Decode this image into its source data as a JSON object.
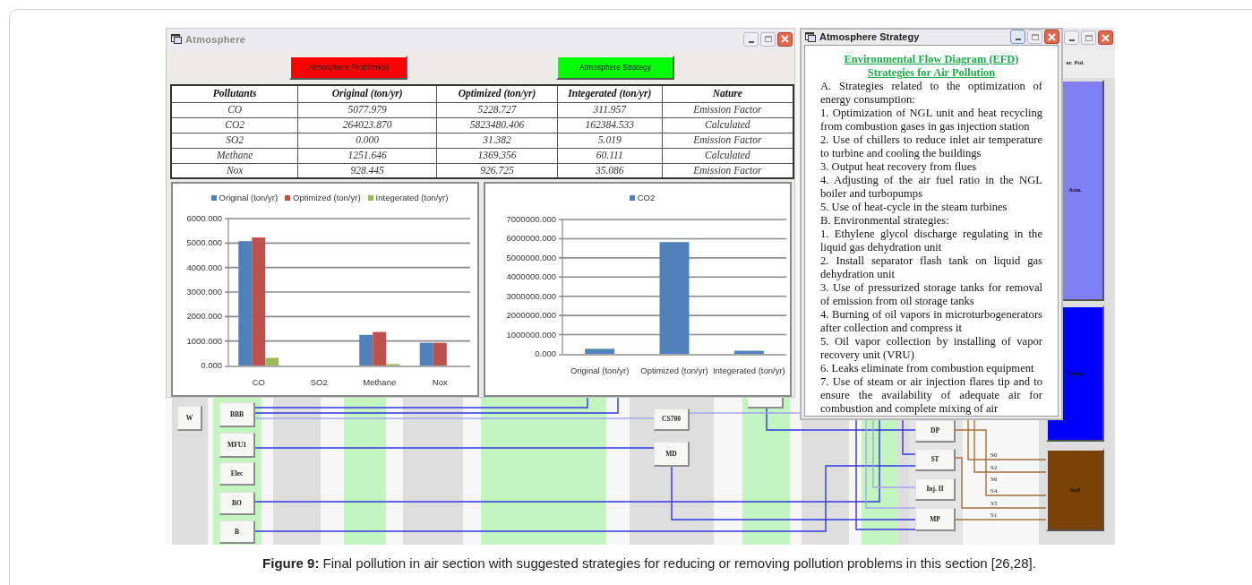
{
  "atmosphere_window": {
    "title": "Atmosphere",
    "buttons": [
      {
        "label": "Atmosphere Problem(s)",
        "color": "#ff0000"
      },
      {
        "label": "Atmosphere Strategy",
        "color": "#00ff00"
      }
    ],
    "table": {
      "columns": [
        "Pollutants",
        "Original (ton/yr)",
        "Optimized (ton/yr)",
        "Integerated (ton/yr)",
        "Nature"
      ],
      "rows": [
        [
          "CO",
          "5077.979",
          "5228.727",
          "311.957",
          "Emission Factor"
        ],
        [
          "CO2",
          "264023.870",
          "5823480.406",
          "162384.533",
          "Calculated"
        ],
        [
          "SO2",
          "0.000",
          "31.382",
          "5.019",
          "Emission Factor"
        ],
        [
          "Methane",
          "1251.646",
          "1369.356",
          "60.111",
          "Calculated"
        ],
        [
          "Nox",
          "928.445",
          "926.725",
          "35.086",
          "Emission Factor"
        ]
      ]
    },
    "charts": [
      {
        "chart_data": {
          "type": "bar",
          "legend": "top",
          "grid": true,
          "categories": [
            "CO",
            "SO2",
            "Methane",
            "Nox"
          ],
          "series": [
            {
              "name": "Original (ton/yr)",
              "color": "#4f81bd",
              "values": [
                5078,
                0,
                1252,
                928
              ]
            },
            {
              "name": "Optimized (ton/yr)",
              "color": "#c0504d",
              "values": [
                5229,
                null,
                1369,
                927
              ]
            },
            {
              "name": "Integerated (ton/yr)",
              "color": "#9bbb59",
              "values": [
                312,
                null,
                60,
                null
              ]
            }
          ],
          "ylim": [
            0,
            6000
          ],
          "yticks": [
            {
              "value": 0,
              "label": "0.000"
            },
            {
              "value": 1000,
              "label": "1000.000"
            },
            {
              "value": 2000,
              "label": "2000.000"
            },
            {
              "value": 3000,
              "label": "3000.000"
            },
            {
              "value": 4000,
              "label": "4000.000"
            },
            {
              "value": 5000,
              "label": "5000.000"
            },
            {
              "value": 6000,
              "label": "6000.000"
            }
          ]
        }
      },
      {
        "chart_data": {
          "type": "bar",
          "legend": "top",
          "grid": true,
          "categories": [
            "Original (ton/yr)",
            "Optimized (ton/yr)",
            "Integerated (ton/yr)"
          ],
          "series": [
            {
              "name": "CO2",
              "color": "#4f81bd",
              "values": [
                264000,
                5823000,
                162000
              ]
            }
          ],
          "ylim": [
            0,
            7000000
          ],
          "yticks": [
            {
              "value": 0,
              "label": "0.000"
            },
            {
              "value": 1000000,
              "label": "1000000.000"
            },
            {
              "value": 2000000,
              "label": "2000000.000"
            },
            {
              "value": 3000000,
              "label": "3000000.000"
            },
            {
              "value": 4000000,
              "label": "4000000.000"
            },
            {
              "value": 5000000,
              "label": "5000000.000"
            },
            {
              "value": 6000000,
              "label": "6000000.000"
            },
            {
              "value": 7000000,
              "label": "7000000.000"
            }
          ]
        }
      }
    ]
  },
  "strategy_window": {
    "title": "Atmosphere Strategy",
    "heading": [
      "Environmental Flow Diagram (EFD)",
      "Strategies for Air Pollution"
    ],
    "paragraphs": [
      "A. Strategies related to the optimization of energy consumption:",
      "1. Optimization of NGL unit and heat recycling from combustion gases in gas injection station",
      "2. Use of chillers to reduce inlet air temperature to turbine and cooling the buildings",
      "3. Output heat recovery from flues",
      "4. Adjusting of the air fuel ratio in the NGL boiler and turbopumps",
      "5. Use of heat-cycle in the steam turbines",
      "B. Environmental strategies:",
      "1. Ethylene glycol discharge regulating in the liquid gas dehydration unit",
      "2. Install separator flash tank on liquid gas dehydration unit",
      "3. Use of pressurized storage tanks for removal of emission from oil storage tanks",
      "4. Burning of oil vapors in microturbogenerators after collection and compress it",
      "5. Oil vapor collection by installing of vapor recovery unit (VRU)",
      "6. Leaks eliminate from combustion equipment",
      "7. Use of steam or air injection flares tip and to ensure the availability of adequate air for combustion and complete mixing of air"
    ]
  },
  "background_window": {
    "header": "er. Pol."
  },
  "diagram": {
    "nodes": [
      {
        "label": "W"
      },
      {
        "label": "BBB"
      },
      {
        "label": "MFU1"
      },
      {
        "label": "Elec"
      },
      {
        "label": "BO"
      },
      {
        "label": "B"
      },
      {
        "label": "CS700"
      },
      {
        "label": "MD"
      },
      {
        "label": "DP"
      },
      {
        "label": "ST"
      },
      {
        "label": "Inj. II"
      },
      {
        "label": "MP"
      }
    ],
    "compartments": [
      {
        "label": "Atm.",
        "color": "#8080f4"
      },
      {
        "label": "Water",
        "color": "#0000ff"
      },
      {
        "label": "Soil",
        "color": "#7a4205"
      }
    ],
    "stream_labels": [
      "S0",
      "S2",
      "S6",
      "S4",
      "S5",
      "S1"
    ]
  },
  "caption": "**Figure 9:** Final pollution in air section with suggested strategies for reducing or removing pollution problems in this section [26,28]."
}
